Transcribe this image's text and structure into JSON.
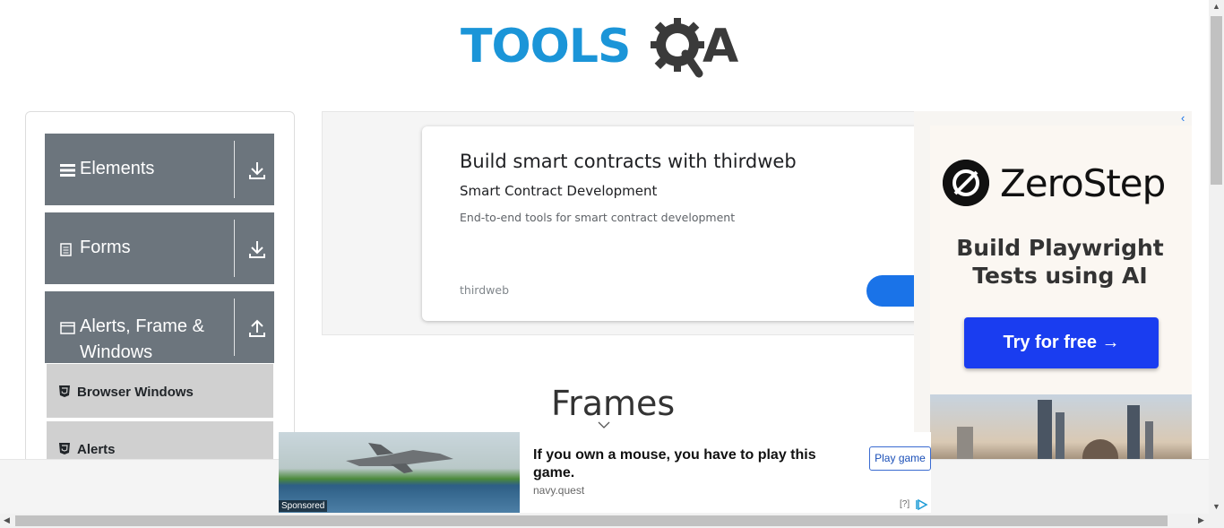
{
  "logo": {
    "tools": "TOOLS",
    "qa_a": "A"
  },
  "sidebar": {
    "groups": [
      {
        "label": "Elements",
        "icon": "hamburger-icon",
        "arrow": "download-icon"
      },
      {
        "label": "Forms",
        "icon": "document-icon",
        "arrow": "download-icon"
      },
      {
        "label_line1": "Alerts, Frame &",
        "label_line2": "Windows",
        "icon": "window-icon",
        "arrow": "upload-icon"
      }
    ],
    "subitems": [
      {
        "label": "Browser Windows"
      },
      {
        "label": "Alerts"
      }
    ]
  },
  "ad_main": {
    "title": "Build smart contracts with thirdweb",
    "subtitle": "Smart Contract Development",
    "description": "End-to-end tools for smart contract development",
    "domain": "thirdweb"
  },
  "ad_side": {
    "brand": "ZeroStep",
    "tagline_line1": "Build Playwright",
    "tagline_line2": "Tests using AI",
    "cta": "Try for free →",
    "colors": {
      "cta": "#1a3df0"
    }
  },
  "main": {
    "heading": "Frames"
  },
  "ad_bottom": {
    "title": "If you own a mouse, you have to play this game.",
    "domain": "navy.quest",
    "button": "Play game",
    "sponsored": "Sponsored",
    "info": "[?]"
  },
  "colors": {
    "sidebar_group": "#6c757d",
    "subitem": "#d0d0d0",
    "logo_blue": "#1b95d8"
  }
}
